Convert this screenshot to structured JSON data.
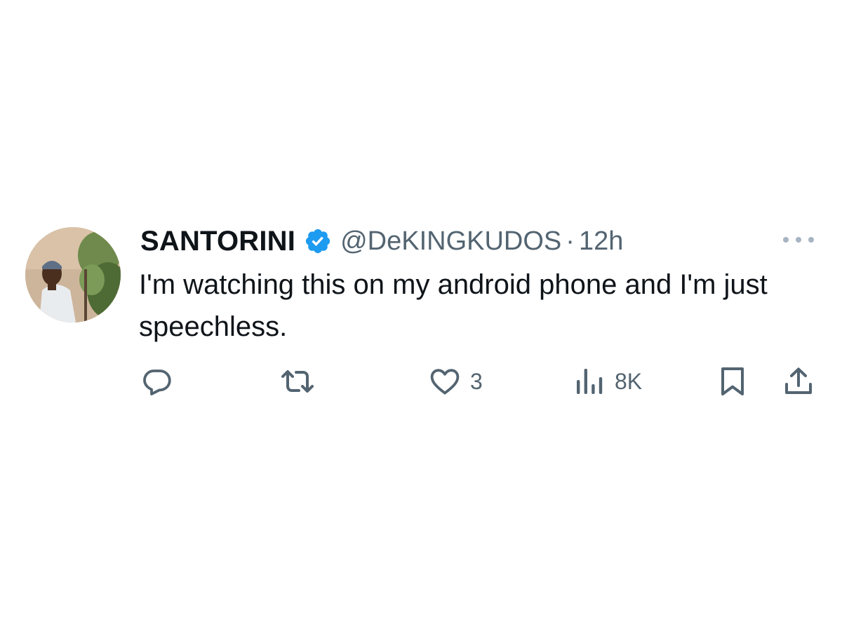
{
  "tweet": {
    "display_name": "SANTORINI",
    "verified": true,
    "handle": "@DeKINGKUDOS",
    "separator": "·",
    "time": "12h",
    "text": "I'm watching this on my android phone and I'm just speechless.",
    "actions": {
      "reply": {
        "icon": "reply-icon",
        "count": ""
      },
      "repost": {
        "icon": "repost-icon",
        "count": ""
      },
      "like": {
        "icon": "heart-icon",
        "count": "3"
      },
      "views": {
        "icon": "views-icon",
        "count": "8K"
      },
      "bookmark": {
        "icon": "bookmark-icon"
      },
      "share": {
        "icon": "share-icon"
      }
    }
  },
  "colors": {
    "text_primary": "#0f1419",
    "text_secondary": "#536471",
    "verified_blue": "#1d9bf0",
    "icon_gray": "#536471"
  }
}
